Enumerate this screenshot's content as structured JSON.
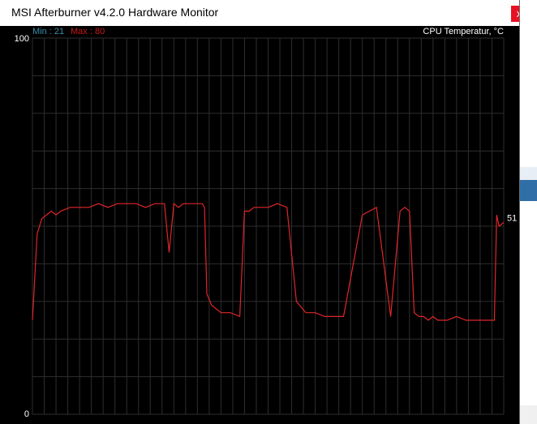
{
  "window": {
    "title": "MSI Afterburner v4.2.0 Hardware Monitor",
    "close_label": "x"
  },
  "graph": {
    "min_label": "Min : 21",
    "max_label": "Max : 80",
    "series_title": "CPU Temperatur, °C",
    "current_value_label": "51",
    "y_max_label": "100",
    "y_min_label": "0",
    "colors": {
      "background": "#000000",
      "grid": "#2e2e2e",
      "line": "#e0262a",
      "min": "#3b8fa8",
      "max": "#c81818",
      "text": "#ffffff"
    }
  },
  "chart_data": {
    "type": "line",
    "title": "CPU Temperatur, °C",
    "ylim": [
      0,
      100
    ],
    "grid": true,
    "series": [
      {
        "name": "CPU Temperatur, °C",
        "x": [
          0,
          1,
          2,
          3,
          4,
          5,
          6,
          8,
          10,
          12,
          14,
          16,
          18,
          20,
          22,
          24,
          26,
          28,
          29,
          30,
          31,
          32,
          34,
          36,
          36.5,
          37,
          38,
          40,
          42,
          44,
          45,
          46,
          47,
          48,
          50,
          52,
          54,
          56,
          58,
          60,
          62,
          64,
          66,
          70,
          73,
          76,
          78,
          79,
          80,
          81,
          82,
          83,
          84,
          85,
          86,
          88,
          90,
          92,
          94,
          96,
          97,
          98,
          98.5,
          99,
          100
        ],
        "y": [
          25,
          48,
          52,
          53,
          54,
          53,
          54,
          55,
          55,
          55,
          56,
          55,
          56,
          56,
          56,
          55,
          56,
          56,
          43,
          56,
          55,
          56,
          56,
          56,
          55,
          32,
          29,
          27,
          27,
          26,
          54,
          54,
          55,
          55,
          55,
          56,
          55,
          30,
          27,
          27,
          26,
          26,
          26,
          53,
          55,
          26,
          54,
          55,
          54,
          27,
          26,
          26,
          25,
          26,
          25,
          25,
          26,
          25,
          25,
          25,
          25,
          25,
          53,
          50,
          51
        ]
      }
    ]
  }
}
